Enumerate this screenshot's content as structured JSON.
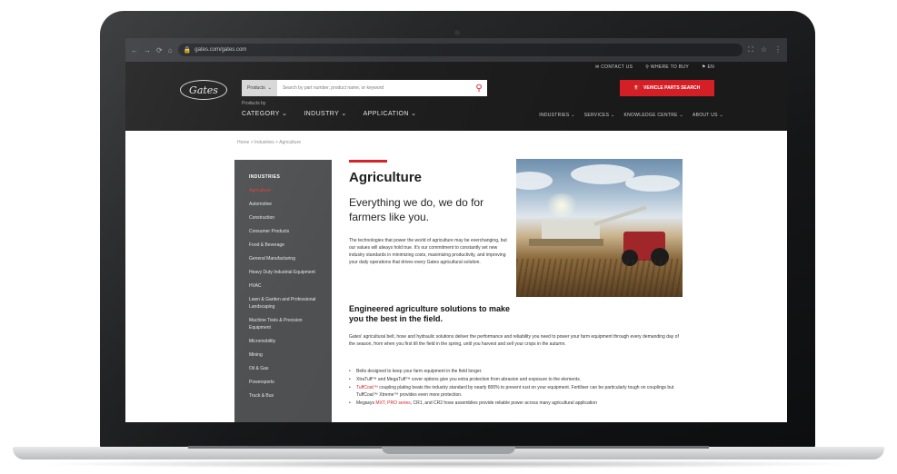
{
  "browser": {
    "url": "gates.com/gates.com",
    "nav_icons": [
      "←",
      "→",
      "⟳",
      "⌂"
    ],
    "right_icons": [
      "⛶",
      "☆",
      "⋮"
    ]
  },
  "header": {
    "utility": [
      "CONTACT US",
      "WHERE TO BUY",
      "EN"
    ],
    "logo_text": "Gates",
    "search": {
      "scope": "Products",
      "placeholder": "Search by part number, product name, or keyword"
    },
    "cta_label": "VEHICLE PARTS SEARCH",
    "products_by": "Products by",
    "main_nav": [
      "CATEGORY ⌄",
      "INDUSTRY ⌄",
      "APPLICATION ⌄"
    ],
    "secondary_nav": [
      "INDUSTRIES ⌄",
      "SERVICES ⌄",
      "KNOWLEDGE CENTRE ⌄",
      "ABOUT US ⌄"
    ]
  },
  "breadcrumb": "Home  >  Industries  >  Agriculture",
  "sidebar": {
    "title": "INDUSTRIES",
    "items": [
      "Agriculture",
      "Automotive",
      "Construction",
      "Consumer Products",
      "Food & Beverage",
      "General Manufacturing",
      "Heavy Duty Industrial Equipment",
      "HVAC",
      "Lawn & Garden and Professional Landscaping",
      "Machine Tools & Precision Equipment",
      "Micromobility",
      "Mining",
      "Oil & Gas",
      "Powersports",
      "Truck & Bus"
    ],
    "active_index": 0
  },
  "content": {
    "title": "Agriculture",
    "subtitle": "Everything we do, we do for farmers like you.",
    "intro": "The technologies that power the world of agriculture may be everchanging, but our values will always hold true. It's our commitment to constantly set new industry standards in minimizing costs, maximizing productivity, and improving your daily operations that drives every Gates agricultural solution.",
    "section_title": "Engineered agriculture solutions to make you the best in the field.",
    "section_text": "Gates' agricultural belt, hose and hydraulic solutions deliver the performance and reliability you need to power your farm equipment through every demanding day of the season, from when you first till the field in the spring, until you harvest and sell your crops in the autumn.",
    "bullets": [
      {
        "pre": "Belts designed to keep your farm equipment in the field longer.",
        "red": "",
        "post": ""
      },
      {
        "pre": "XtraTuff™ and MegaTuff™ cover options give you extra protection from abrasion and exposure to the elements.",
        "red": "",
        "post": ""
      },
      {
        "pre": "",
        "red": "TuffCoat™",
        "post": " coupling plating beats the industry standard by nearly 800% to prevent rust on your equipment. Fertiliser can be particularly tough on couplings but TuffCoat™ Xtreme™ provides even more protection."
      },
      {
        "pre": "Megasys ",
        "red": "MXT, PRO series",
        "post": ", CR1, and CR2 hose assemblies provide reliable power across many agricultural application"
      }
    ]
  },
  "colors": {
    "brand_red": "#d51f26",
    "header_dark": "#1a1a1a",
    "sidebar_gray": "#4b4d4f"
  }
}
